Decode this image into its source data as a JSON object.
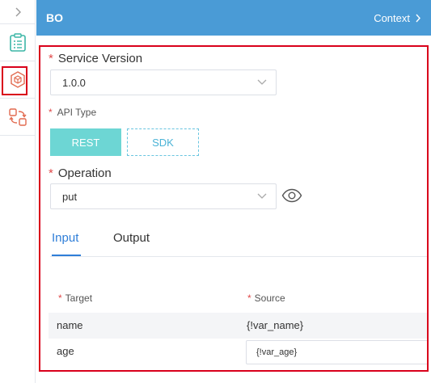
{
  "rail": {
    "collapse_icon": "chevron-right-icon",
    "items": [
      {
        "name": "list-icon",
        "color": "#3bb6a6"
      },
      {
        "name": "cube-icon",
        "color": "#e26a4f",
        "selected": true
      },
      {
        "name": "convert-icon",
        "color": "#e26a4f"
      }
    ]
  },
  "header": {
    "title": "BO",
    "context_label": "Context"
  },
  "form": {
    "service_version": {
      "label": "Service Version",
      "value": "1.0.0"
    },
    "api_type": {
      "label": "API Type",
      "options": [
        "REST",
        "SDK"
      ],
      "selected": "REST"
    },
    "operation": {
      "label": "Operation",
      "value": "put"
    }
  },
  "tabs": {
    "input_label": "Input",
    "output_label": "Output",
    "active": "Input"
  },
  "table": {
    "col_target": "Target",
    "col_source": "Source",
    "rows": [
      {
        "target": "name",
        "source": "{!var_name}"
      },
      {
        "target": "age",
        "source": "{!var_age}"
      }
    ]
  },
  "colors": {
    "header_bg": "#4a9bd6",
    "rest_active_bg": "#6dd6d4",
    "sdk_border": "#68c5e0",
    "required": "#e04848",
    "tab_active": "#2f7ed8",
    "highlight": "#d9001b"
  }
}
